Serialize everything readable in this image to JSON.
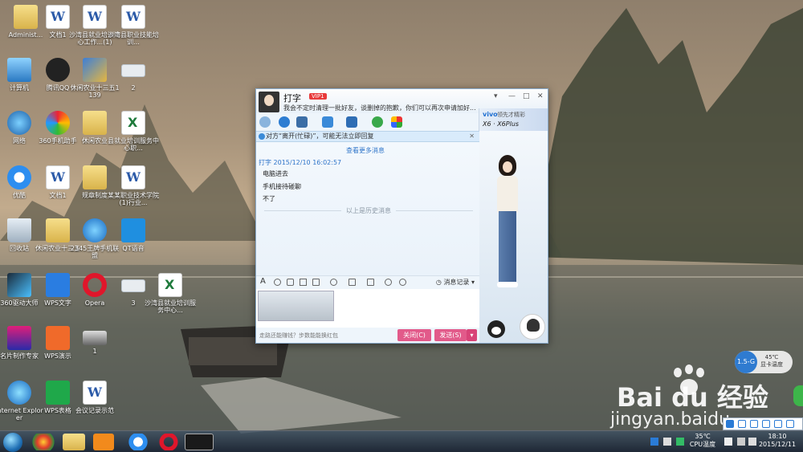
{
  "desktop_icons": [
    {
      "label": "Administ..."
    },
    {
      "label": "文档1"
    },
    {
      "label": "沙湾县就业培训中心工作...(1)"
    },
    {
      "label": "沙湾县职业技能培训..."
    },
    {
      "label": "计算机"
    },
    {
      "label": "腾讯QQ"
    },
    {
      "label": "休闲农业十三五1139"
    },
    {
      "label": "2"
    },
    {
      "label": "网络"
    },
    {
      "label": "360手机助手"
    },
    {
      "label": "休闲农业"
    },
    {
      "label": "县就业培训服务中心职..."
    },
    {
      "label": "优酷"
    },
    {
      "label": "文档1"
    },
    {
      "label": "规章制度"
    },
    {
      "label": "某某职业技术学院(1)行业..."
    },
    {
      "label": "回收站"
    },
    {
      "label": "休闲农业十三五"
    },
    {
      "label": "2345王牌手机联盟"
    },
    {
      "label": "QT语音"
    },
    {
      "label": "360驱动大师"
    },
    {
      "label": "WPS文字"
    },
    {
      "label": "Opera"
    },
    {
      "label": "3"
    },
    {
      "label": "沙湾县就业培训服务中心..."
    },
    {
      "label": "名片制作专家"
    },
    {
      "label": "WPS演示"
    },
    {
      "label": "1"
    },
    {
      "label": "Internet Explorer"
    },
    {
      "label": "WPS表格"
    },
    {
      "label": "会议记录示范"
    }
  ],
  "chat_window": {
    "contact_name": "打字",
    "vip_badge": "VIP1",
    "signature": "我会不定时清理一批好友，谈删掉的抱歉，你们可以再次申请加好...",
    "window_controls": {
      "menu": "▾",
      "minimize": "—",
      "maximize": "□",
      "close": "✕"
    },
    "ad": {
      "brand": "vivo",
      "text": "领先才精彩",
      "model": "X6 · X6Plus"
    },
    "notice": "对方“离开(忙碌)”，可能无法立即回复",
    "notice_close": "✕",
    "more_messages": "查看更多消息",
    "sender_line": "打字 2015/12/10 16:02:57",
    "messages": [
      "电脑进去",
      "手机接待碰聊",
      "不了"
    ],
    "history_divider": "以上是历史消息",
    "message_history": "消息记录",
    "footer_tip": "走路还能赚钱？步数能能换红包",
    "close_button": "关闭(C)",
    "send_button": "发送(S)",
    "send_dropdown": "▾"
  },
  "taskbar": {
    "cpu_temp": "35℃",
    "cpu_label": "CPU温度",
    "time": "18:10",
    "date": "2015/12/11"
  },
  "widget": {
    "speed": "1.5-G",
    "temp": "45℃",
    "label": "显卡温度"
  },
  "watermark": {
    "brand": "Bai du 经验",
    "url": "jingyan.baidu"
  }
}
